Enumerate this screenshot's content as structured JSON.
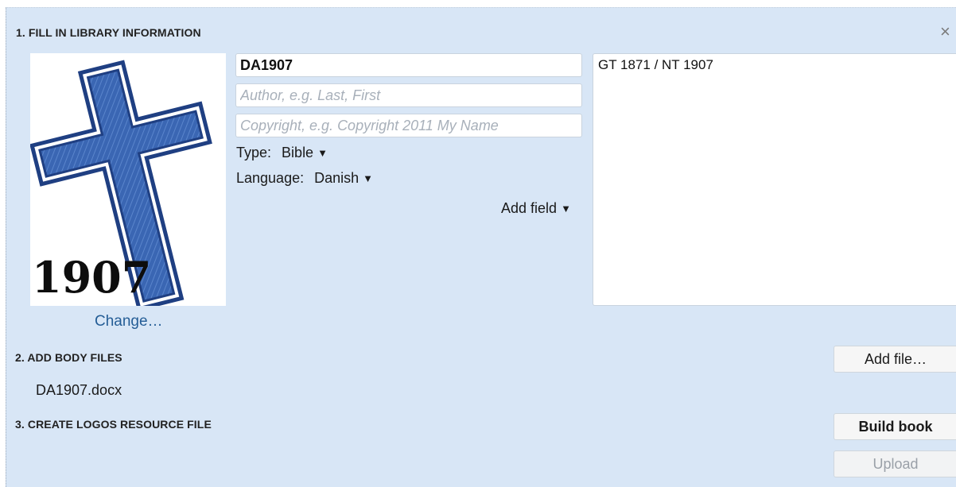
{
  "sections": {
    "library_info": "1. FILL IN LIBRARY INFORMATION",
    "body_files": "2. ADD BODY FILES",
    "resource_file": "3. CREATE LOGOS RESOURCE FILE"
  },
  "close_glyph": "×",
  "cover": {
    "year_text": "1907",
    "change_label": "Change…",
    "colors": {
      "cross_fill": "#3a66b3",
      "cross_outline": "#1f3f82"
    }
  },
  "fields": {
    "title_value": "DA1907",
    "author_placeholder": "Author, e.g. Last, First",
    "copyright_placeholder": "Copyright, e.g. Copyright 2011 My Name",
    "type_label": "Type:",
    "type_value": "Bible",
    "language_label": "Language:",
    "language_value": "Danish",
    "add_field_label": "Add field",
    "dropdown_glyph": "▼"
  },
  "description_value": "GT 1871 / NT 1907",
  "body_files": [
    "DA1907.docx"
  ],
  "buttons": {
    "add_file": "Add file…",
    "build_book": "Build book",
    "upload": "Upload"
  }
}
